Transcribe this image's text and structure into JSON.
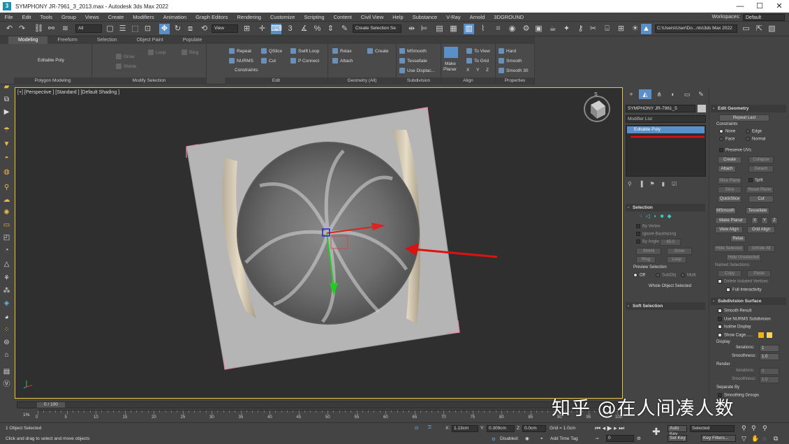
{
  "window": {
    "title": "SYMPHONY JR-7961_3_2013.max - Autodesk 3ds Max 2022",
    "minimize": "—",
    "maximize": "☐",
    "close": "✕"
  },
  "menu": {
    "items": [
      "File",
      "Edit",
      "Tools",
      "Group",
      "Views",
      "Create",
      "Modifiers",
      "Animation",
      "Graph Editors",
      "Rendering",
      "Customize",
      "Scripting",
      "Content",
      "Civil View",
      "Help",
      "Substance",
      "V-Ray",
      "Arnold",
      "3DGROUND"
    ],
    "workspace_label": "Workspaces:",
    "workspace_value": "Default"
  },
  "toolbar": {
    "filter_select": "All",
    "view_select": "View",
    "snap_number": "3",
    "selection_set": "Create Selection Se",
    "project_path": "C:\\Users\\User\\Do...nts\\3ds Max 2022"
  },
  "ribbon": {
    "tabs": [
      "Modeling",
      "Freeform",
      "Selection",
      "Object Paint",
      "Populate"
    ],
    "poly_modeling_label": "Polygon Modeling",
    "edit_poly_label": "Editable Poly",
    "modify_selection_label": "Modify Selection",
    "grow": "Grow",
    "shrink": "Shrink",
    "loop": "Loop",
    "ring": "Ring",
    "edit_label": "Edit",
    "repeat": "Repeat",
    "qslice": "QSlice",
    "swift_loop": "Swift Loop",
    "nurms": "NURMS",
    "cut": "Cut",
    "p_connect": "P Connect",
    "constraints": "Constraints:",
    "geometry_label": "Geometry (All)",
    "relax": "Relax",
    "create": "Create",
    "attach": "Attach",
    "subdivision_label": "Subdivision",
    "msmooth": "MSmooth",
    "tessellate": "Tessellate",
    "use_displac": "Use Displac...",
    "align_label": "Align",
    "make_planar_1": "Make",
    "make_planar_2": "Planar",
    "to_view": "To View",
    "to_grid": "To Grid",
    "x": "X",
    "y": "Y",
    "z": "Z",
    "properties_label": "Properties",
    "hard": "Hard",
    "smooth": "Smooth",
    "smooth30": "Smooth 30"
  },
  "viewport": {
    "label": "[+] [Perspective ] [Standard ] [Default Shading ]",
    "viewcube_s": "S"
  },
  "command_panel": {
    "object_name": "SYMPHONY JR-7961_5",
    "modifier_list": "Modifier List",
    "stack_item": "Editable Poly",
    "selection_title": "Selection",
    "by_vertex": "By Vertex",
    "ignore_backfacing": "Ignore Backfacing",
    "by_angle": "By Angle:",
    "by_angle_value": "45.0",
    "shrink": "Shrink",
    "grow": "Grow",
    "ring": "Ring",
    "loop": "Loop",
    "preview_selection": "Preview Selection",
    "off": "Off",
    "subobj": "SubObj",
    "multi": "Multi",
    "whole_object": "Whole Object Selected",
    "soft_selection": "Soft Selection"
  },
  "edit_geometry": {
    "title": "Edit Geometry",
    "repeat_last": "Repeat Last",
    "constraints": "Constraints",
    "none": "None",
    "edge": "Edge",
    "face": "Face",
    "normal": "Normal",
    "preserve_uvs": "Preserve UVs",
    "create": "Create",
    "collapse": "Collapse",
    "attach": "Attach",
    "detach": "Detach",
    "slice_plane": "Slice Plane",
    "split": "Split",
    "slice": "Slice",
    "reset_plane": "Reset Plane",
    "quickslice": "QuickSlice",
    "cut": "Cut",
    "msmooth": "MSmooth",
    "tessellate": "Tessellate",
    "make_planar": "Make Planar",
    "x": "X",
    "y": "Y",
    "z": "Z",
    "view_align": "View Align",
    "grid_align": "Grid Align",
    "relax": "Relax",
    "hide_selected": "Hide Selected",
    "unhide_all": "Unhide All",
    "hide_unselected": "Hide Unselected",
    "named_selections": "Named Selections:",
    "copy": "Copy",
    "paste": "Paste",
    "delete_isolated": "Delete Isolated Vertices",
    "full_interactivity": "Full Interactivity",
    "subdiv_title": "Subdivision Surface",
    "smooth_result": "Smooth Result",
    "use_nurms": "Use NURMS Subdivision",
    "isoline": "Isoline Display",
    "show_cage": "Show Cage......",
    "display": "Display",
    "iterations": "Iterations:",
    "iterations_val": "1",
    "smoothness": "Smoothness:",
    "smoothness_val": "1.0",
    "render": "Render",
    "r_iterations_val": "0",
    "r_smoothness_val": "1.0",
    "separate_by": "Separate By",
    "smoothing_groups": "Smoothing Groups",
    "cage_color_1": "#f2b21c",
    "cage_color_2": "#f5d65a"
  },
  "timeline": {
    "slider": "0 / 100",
    "ticks": [
      "0",
      "5",
      "10",
      "15",
      "20",
      "25",
      "30",
      "35",
      "40",
      "45",
      "50",
      "55",
      "60",
      "65",
      "70",
      "75",
      "80",
      "85",
      "90",
      "95",
      "100"
    ]
  },
  "status": {
    "selected": "1 Object Selected",
    "prompt": "Click and drag to select and move objects",
    "x_label": "X:",
    "x_val": "1.13cm",
    "y_label": "Y:",
    "y_val": "0.309cm",
    "z_label": "Z:",
    "z_val": "0.0cm",
    "grid": "Grid = 1.0cm",
    "disabled": "Disabled:",
    "add_time_tag": "Add Time Tag",
    "auto_key": "Auto Key",
    "set_key": "Set Key",
    "selected_dd": "Selected",
    "key_filters": "Key Filters...",
    "frame": "0",
    "mini_listener": "1%"
  },
  "watermark": "知乎 @在人间凑人数"
}
